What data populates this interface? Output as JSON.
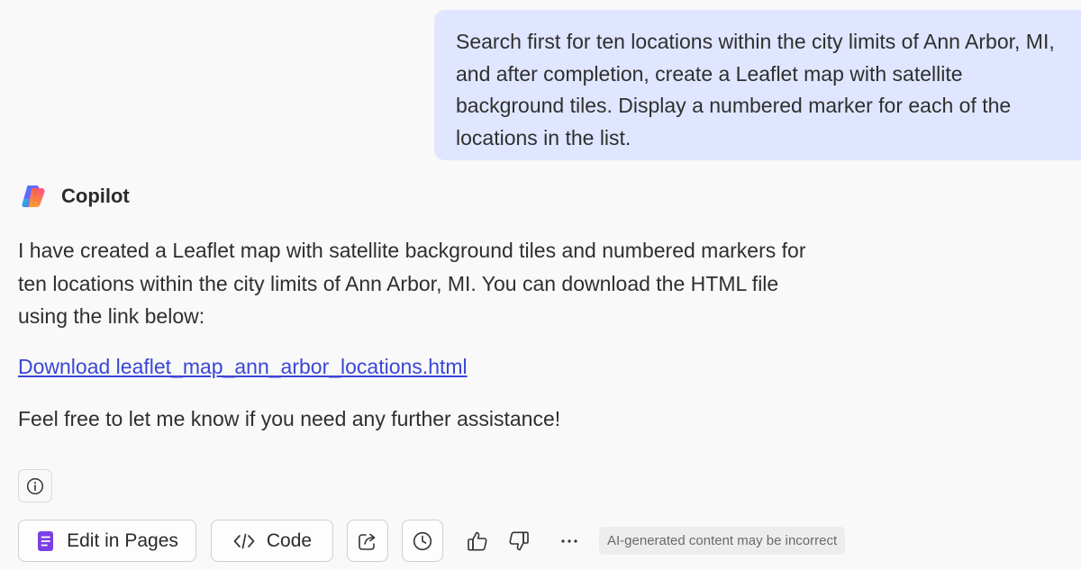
{
  "user_message": {
    "text": "Search first for ten locations within the city limits of Ann Arbor, MI, and after completion, create a Leaflet map with satellite background tiles. Display a numbered marker for each of the locations in the list."
  },
  "assistant": {
    "name": "Copilot",
    "logo_icon": "copilot-logo-icon",
    "paragraph_1": "I have created a Leaflet map with satellite background tiles and numbered markers for ten locations within the city limits of Ann Arbor, MI. You can download the HTML file using the link below:",
    "link_text": "Download leaflet_map_ann_arbor_locations.html",
    "paragraph_2": "Feel free to let me know if you need any further assistance!"
  },
  "info_icon": "info-icon",
  "actions": {
    "edit_in_pages": {
      "label": "Edit in Pages",
      "icon": "pages-icon"
    },
    "code": {
      "label": "Code",
      "icon": "code-icon"
    },
    "share_icon": "share-icon",
    "history_icon": "clock-icon",
    "like_icon": "thumbs-up-icon",
    "dislike_icon": "thumbs-down-icon",
    "more_icon": "more-icon",
    "disclaimer": "AI-generated content may be incorrect"
  },
  "colors": {
    "background": "#f9f9f9",
    "user_bubble": "#e0e6ff",
    "link": "#3a46d6",
    "pages_icon": "#7b3fe4",
    "disclaimer_bg": "#ededed"
  }
}
